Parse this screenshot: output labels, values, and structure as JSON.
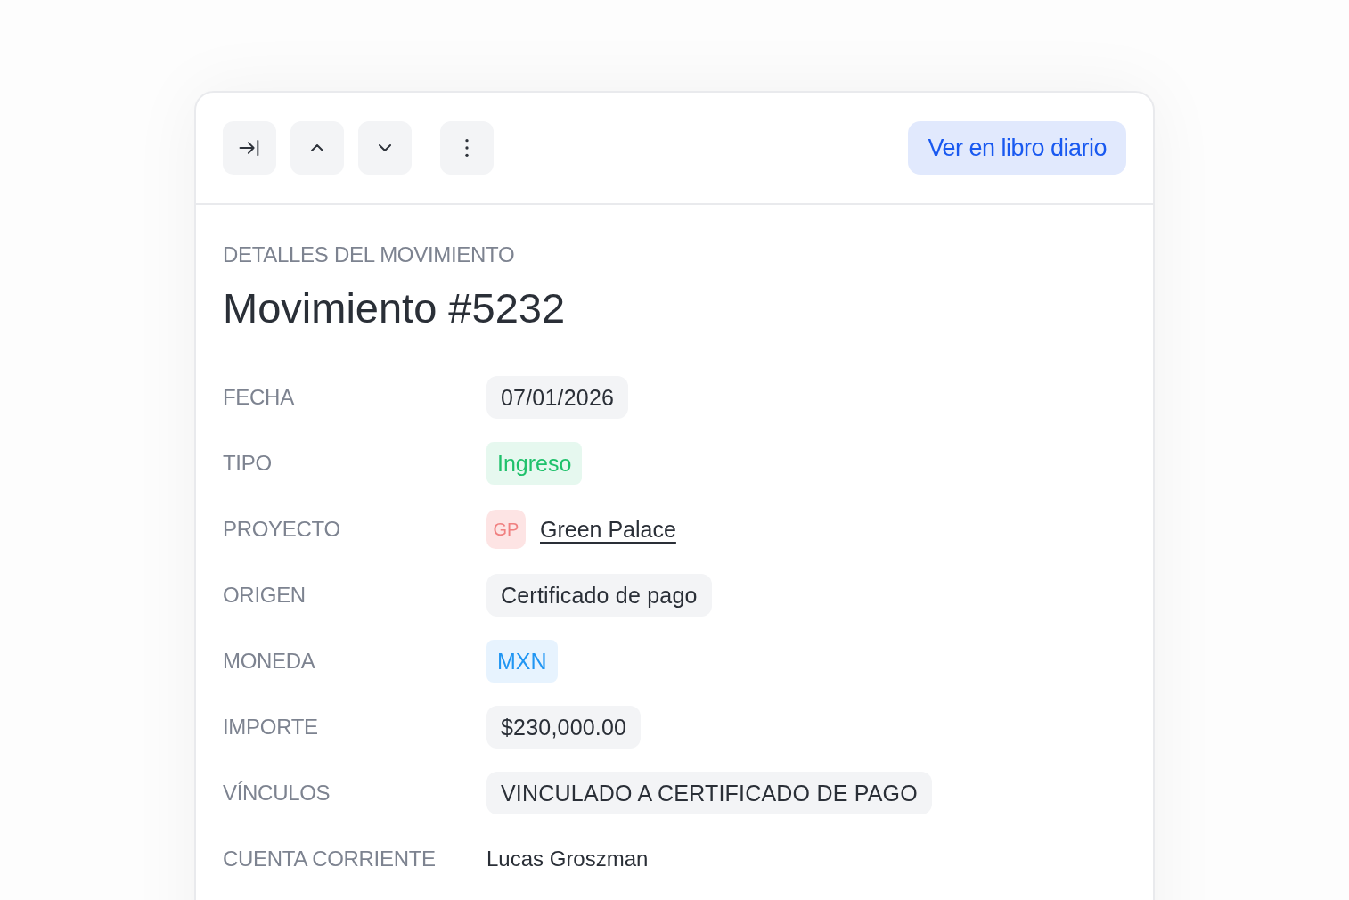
{
  "toolbar": {
    "buttons": [
      {
        "kind": "collapse"
      },
      {
        "kind": "up"
      },
      {
        "kind": "down"
      },
      {
        "kind": "more"
      }
    ],
    "action": "Ver en libro diario"
  },
  "section_label": "DETALLES DEL MOVIMIENTO",
  "title": "Movimiento #5232",
  "fields": [
    {
      "label": "FECHA",
      "kind": "pill",
      "value": "07/01/2026"
    },
    {
      "label": "TIPO",
      "kind": "tag",
      "value": "Ingreso",
      "color": "#1fc16b"
    },
    {
      "label": "PROYECTO",
      "kind": "project",
      "initials": "GP",
      "value": "Green Palace"
    },
    {
      "label": "ORIGEN",
      "kind": "pill",
      "value": "Certificado de pago"
    },
    {
      "label": "MONEDA",
      "kind": "tag",
      "value": "MXN",
      "color": "#2196f3"
    },
    {
      "label": "IMPORTE",
      "kind": "pill",
      "value": "$230,000.00"
    },
    {
      "label": "VÍNCULOS",
      "kind": "pill",
      "value": "VINCULADO A CERTIFICADO DE PAGO"
    },
    {
      "label": "CUENTA CORRIENTE",
      "kind": "text",
      "value": "Lucas Groszman"
    }
  ]
}
